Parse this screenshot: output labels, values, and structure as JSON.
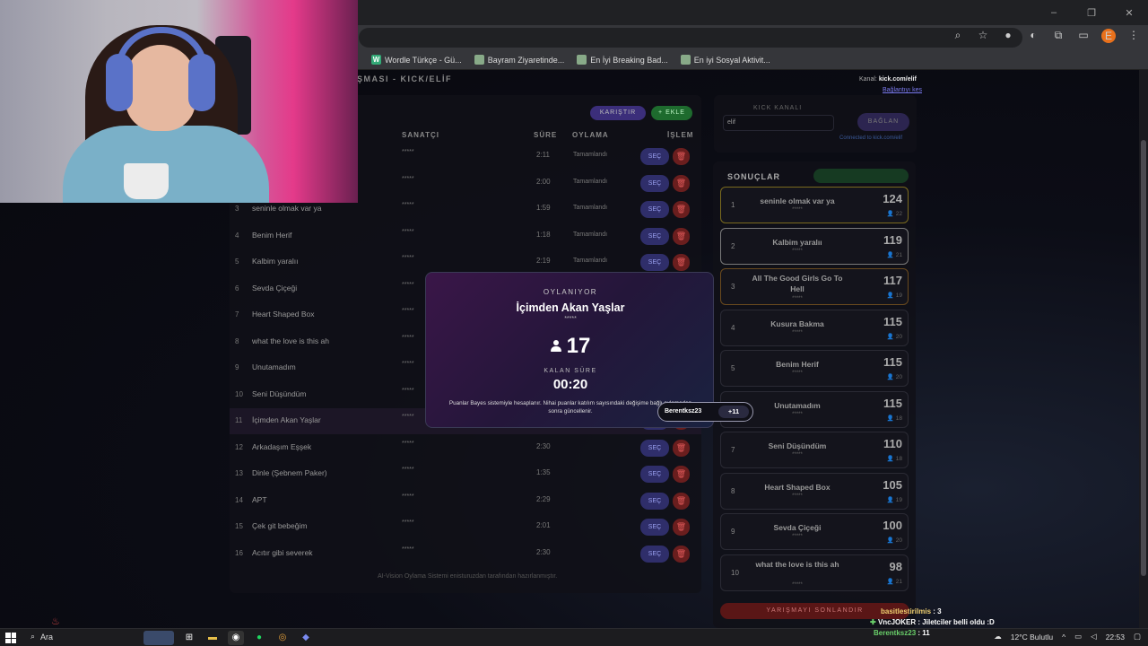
{
  "browser": {
    "window_controls": [
      "–",
      "❐",
      "✕"
    ],
    "toolbar_icons": [
      "zoom-icon",
      "star-icon",
      "profile-icon",
      "extensions-icon"
    ],
    "profile_initial": "E",
    "bookmarks": [
      {
        "label": "Wordle Türkçe - Gü...",
        "icon": "W"
      },
      {
        "label": "Bayram Ziyaretinde...",
        "icon": ""
      },
      {
        "label": "En İyi Breaking Bad...",
        "icon": ""
      },
      {
        "label": "En iyi Sosyal Aktivit...",
        "icon": ""
      }
    ]
  },
  "page": {
    "title": "ŞMASI - KICK/ELİF",
    "channel_label": "Kanal:",
    "channel_value": "kick.com/elif",
    "connect_link": "Bağlantıyı kes",
    "shuffle_label": "KARIŞTIR",
    "add_label": "+ EKLE",
    "col_artist": "SANATÇI",
    "col_duration": "SÜRE",
    "col_vote": "OYLAMA",
    "col_action": "İŞLEM",
    "select_label": "SEÇ",
    "footer_note": "AI-Vision Oylama Sistemi enisturuzdan tarafından hazırlanmıştır.",
    "kick_label": "KICK KANALI",
    "kick_input": "elif",
    "kick_btn": "BAĞLAN",
    "kick_status": "Connected to kick.com/elif",
    "results_title": "SONUÇLAR",
    "end_label": "YARIŞMAYI SONLANDIR"
  },
  "songs": [
    {
      "num": "1",
      "title": "",
      "artist": "*****",
      "duration": "2:11",
      "status": "Tamamlandı"
    },
    {
      "num": "2",
      "title": "",
      "artist": "*****",
      "duration": "2:00",
      "status": "Tamamlandı"
    },
    {
      "num": "3",
      "title": "seninle olmak var ya",
      "artist": "*****",
      "duration": "1:59",
      "status": "Tamamlandı"
    },
    {
      "num": "4",
      "title": "Benim Herif",
      "artist": "*****",
      "duration": "1:18",
      "status": "Tamamlandı"
    },
    {
      "num": "5",
      "title": "Kalbim yaralıı",
      "artist": "*****",
      "duration": "2:19",
      "status": "Tamamlandı"
    },
    {
      "num": "6",
      "title": "Sevda Çiçeği",
      "artist": "*****",
      "duration": "",
      "status": ""
    },
    {
      "num": "7",
      "title": "Heart Shaped Box",
      "artist": "*****",
      "duration": "",
      "status": ""
    },
    {
      "num": "8",
      "title": "what the love is this ah",
      "artist": "*****",
      "duration": "",
      "status": ""
    },
    {
      "num": "9",
      "title": "Unutamadım",
      "artist": "*****",
      "duration": "",
      "status": ""
    },
    {
      "num": "10",
      "title": "Seni Düşündüm",
      "artist": "*****",
      "duration": "",
      "status": ""
    },
    {
      "num": "11",
      "title": "İçimden Akan Yaşlar",
      "artist": "*****",
      "duration": "",
      "status": ""
    },
    {
      "num": "12",
      "title": "Arkadaşım Eşşek",
      "artist": "*****",
      "duration": "2:30",
      "status": ""
    },
    {
      "num": "13",
      "title": "Dinle (Şebnem Paker)",
      "artist": "*****",
      "duration": "1:35",
      "status": ""
    },
    {
      "num": "14",
      "title": "APT",
      "artist": "*****",
      "duration": "2:29",
      "status": ""
    },
    {
      "num": "15",
      "title": "Çek git bebeğim",
      "artist": "*****",
      "duration": "2:01",
      "status": ""
    },
    {
      "num": "16",
      "title": "Acıtır gibi severek",
      "artist": "*****",
      "duration": "2:30",
      "status": ""
    }
  ],
  "results": [
    {
      "rank": "1",
      "title": "seninle olmak var ya",
      "stars": "*****",
      "votes": "124",
      "voters": "22",
      "tier": "gold"
    },
    {
      "rank": "2",
      "title": "Kalbim yaralıı",
      "stars": "*****",
      "votes": "119",
      "voters": "21",
      "tier": "silver"
    },
    {
      "rank": "3",
      "title": "All The Good Girls Go To Hell",
      "stars": "*****",
      "votes": "117",
      "voters": "19",
      "tier": "bronze"
    },
    {
      "rank": "4",
      "title": "Kusura Bakma",
      "stars": "*****",
      "votes": "115",
      "voters": "20",
      "tier": ""
    },
    {
      "rank": "5",
      "title": "Benim Herif",
      "stars": "*****",
      "votes": "115",
      "voters": "20",
      "tier": ""
    },
    {
      "rank": "6",
      "title": "Unutamadım",
      "stars": "*****",
      "votes": "115",
      "voters": "18",
      "tier": ""
    },
    {
      "rank": "7",
      "title": "Seni Düşündüm",
      "stars": "*****",
      "votes": "110",
      "voters": "18",
      "tier": ""
    },
    {
      "rank": "8",
      "title": "Heart Shaped Box",
      "stars": "*****",
      "votes": "105",
      "voters": "19",
      "tier": ""
    },
    {
      "rank": "9",
      "title": "Sevda Çiçeği",
      "stars": "*****",
      "votes": "100",
      "voters": "20",
      "tier": ""
    },
    {
      "rank": "10",
      "title": "what the love is this ah",
      "stars": "*****",
      "votes": "98",
      "voters": "21",
      "tier": ""
    }
  ],
  "voting": {
    "status": "OYLANIYOR",
    "song": "İçimden Akan Yaşlar",
    "stars": "*****",
    "count": "17",
    "remaining_label": "KALAN SÜRE",
    "time": "00:20",
    "note": "Puanlar Bayes sistemiyle hesaplanır. Nihai puanlar katılım sayısındaki değişime bağlı oylamadan sonra güncellenir.",
    "toast_user": "Berentksz23",
    "toast_value": "+11"
  },
  "chat": [
    {
      "user": "basitlestirilmis",
      "text": ": 3"
    },
    {
      "user": "VncJOKER",
      "text": ": Jiletciler belli oldu :D"
    },
    {
      "user": "Berentksz23",
      "text": ": 11"
    }
  ],
  "taskbar": {
    "search": "Ara",
    "weather": "12°C  Bulutlu",
    "time": "22:53"
  }
}
